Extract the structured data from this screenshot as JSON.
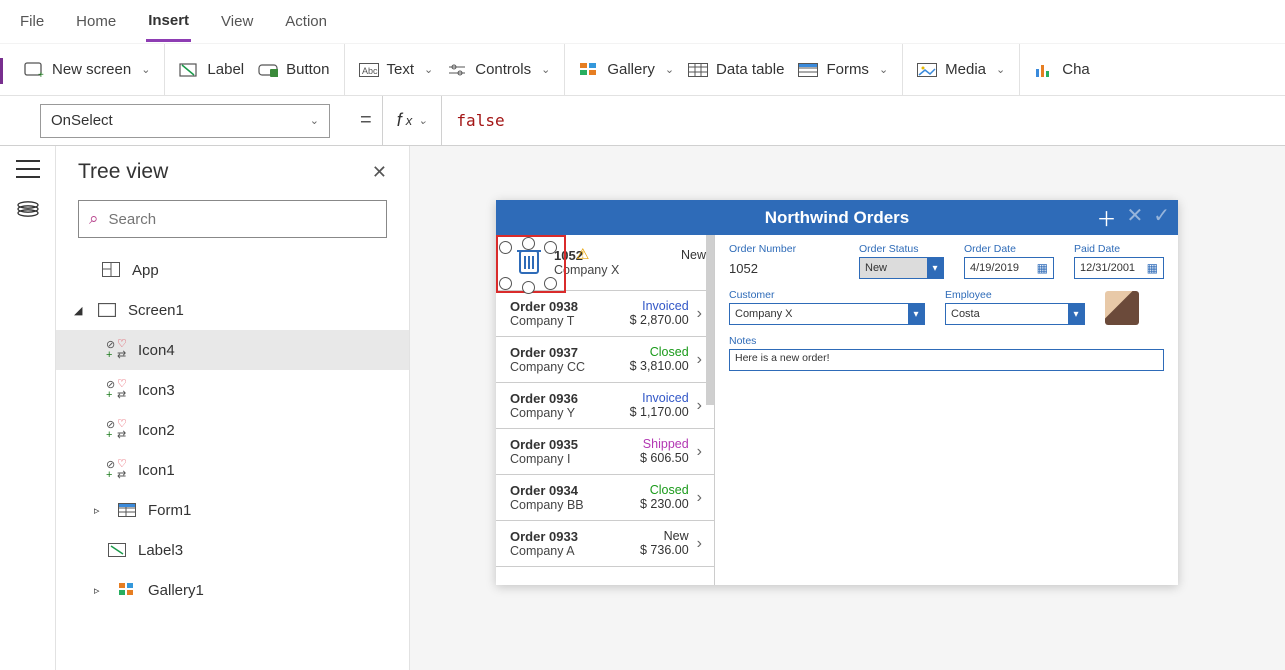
{
  "menu": {
    "items": [
      "File",
      "Home",
      "Insert",
      "View",
      "Action"
    ],
    "active": 2
  },
  "ribbon": {
    "new_screen": "New screen",
    "label": "Label",
    "button": "Button",
    "text": "Text",
    "controls": "Controls",
    "gallery": "Gallery",
    "data_table": "Data table",
    "forms": "Forms",
    "media": "Media",
    "charts": "Cha"
  },
  "formula": {
    "property": "OnSelect",
    "expression": "false"
  },
  "tree": {
    "title": "Tree view",
    "search_placeholder": "Search",
    "nodes": {
      "app": "App",
      "screen1": "Screen1",
      "icon4": "Icon4",
      "icon3": "Icon3",
      "icon2": "Icon2",
      "icon1": "Icon1",
      "form1": "Form1",
      "label3": "Label3",
      "gallery1": "Gallery1"
    }
  },
  "app_preview": {
    "title": "Northwind Orders",
    "orders": [
      {
        "num": "1052",
        "company": "Company X",
        "status": "New",
        "amount": "",
        "status_cls": "st-new"
      },
      {
        "num": "Order 0938",
        "company": "Company T",
        "status": "Invoiced",
        "amount": "$ 2,870.00",
        "status_cls": "st-invoiced"
      },
      {
        "num": "Order 0937",
        "company": "Company CC",
        "status": "Closed",
        "amount": "$ 3,810.00",
        "status_cls": "st-closed"
      },
      {
        "num": "Order 0936",
        "company": "Company Y",
        "status": "Invoiced",
        "amount": "$ 1,170.00",
        "status_cls": "st-invoiced"
      },
      {
        "num": "Order 0935",
        "company": "Company I",
        "status": "Shipped",
        "amount": "$ 606.50",
        "status_cls": "st-shipped"
      },
      {
        "num": "Order 0934",
        "company": "Company BB",
        "status": "Closed",
        "amount": "$ 230.00",
        "status_cls": "st-closed"
      },
      {
        "num": "Order 0933",
        "company": "Company A",
        "status": "New",
        "amount": "$ 736.00",
        "status_cls": "st-new"
      }
    ],
    "form": {
      "order_number": {
        "label": "Order Number",
        "value": "1052"
      },
      "order_status": {
        "label": "Order Status",
        "value": "New"
      },
      "order_date": {
        "label": "Order Date",
        "value": "4/19/2019"
      },
      "paid_date": {
        "label": "Paid Date",
        "value": "12/31/2001"
      },
      "customer": {
        "label": "Customer",
        "value": "Company X"
      },
      "employee": {
        "label": "Employee",
        "value": "Costa"
      },
      "notes": {
        "label": "Notes",
        "value": "Here is a new order!"
      }
    }
  }
}
